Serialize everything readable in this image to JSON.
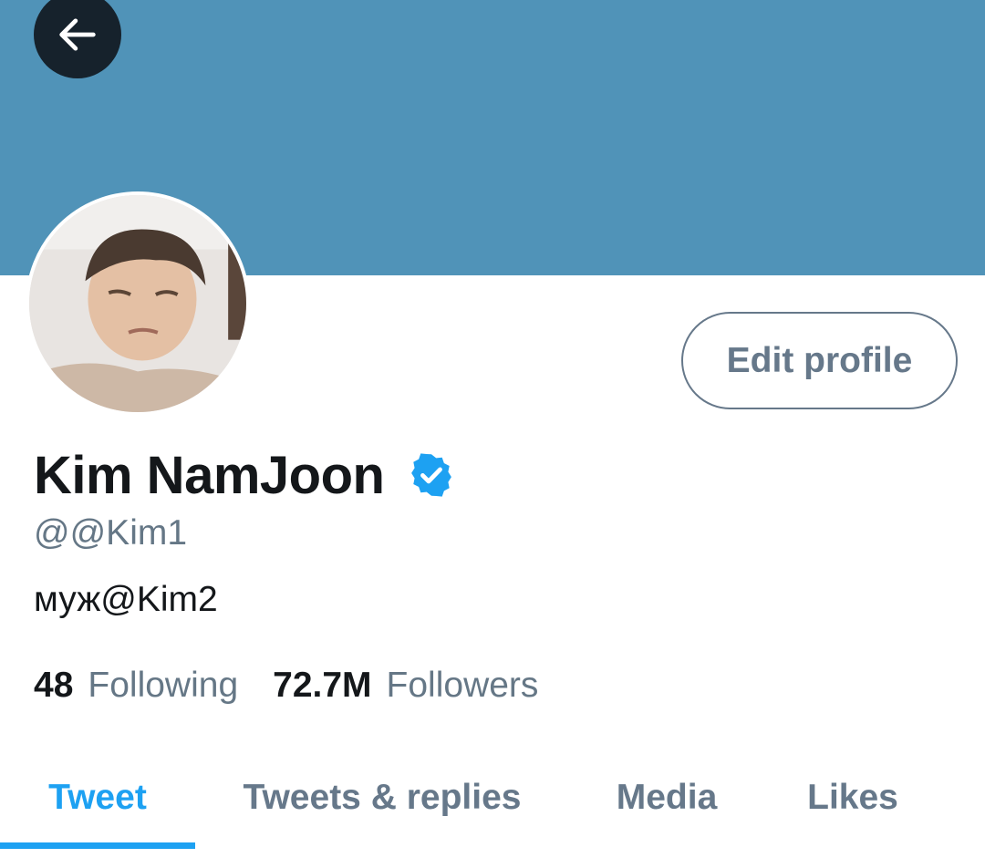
{
  "header": {
    "back_icon": "arrow-left-icon",
    "banner_color": "#5093b8"
  },
  "profile": {
    "display_name": "Kim NamJoon",
    "verified_icon": "verified-badge-icon",
    "handle": "@@Kim1",
    "bio": "муж@Kim2",
    "edit_button_label": "Edit profile"
  },
  "stats": {
    "following_count": "48",
    "following_label": "Following",
    "followers_count": "72.7M",
    "followers_label": "Followers"
  },
  "tabs": [
    {
      "label": "Tweet",
      "active": true
    },
    {
      "label": "Tweets & replies",
      "active": false
    },
    {
      "label": "Media",
      "active": false
    },
    {
      "label": "Likes",
      "active": false
    }
  ],
  "colors": {
    "accent": "#1da1f2",
    "text_primary": "#14171a",
    "text_secondary": "#657786"
  }
}
